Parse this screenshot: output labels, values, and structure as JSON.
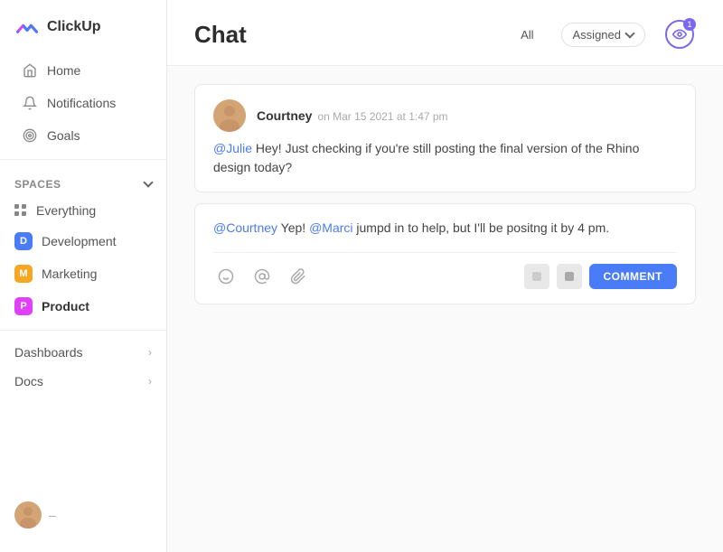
{
  "app": {
    "name": "ClickUp"
  },
  "sidebar": {
    "nav": [
      {
        "id": "home",
        "label": "Home",
        "icon": "home-icon"
      },
      {
        "id": "notifications",
        "label": "Notifications",
        "icon": "bell-icon"
      },
      {
        "id": "goals",
        "label": "Goals",
        "icon": "goal-icon"
      }
    ],
    "spaces_label": "Spaces",
    "spaces": [
      {
        "id": "everything",
        "label": "Everything",
        "type": "dots"
      },
      {
        "id": "development",
        "label": "Development",
        "type": "badge",
        "color": "blue",
        "letter": "D"
      },
      {
        "id": "marketing",
        "label": "Marketing",
        "type": "badge",
        "color": "orange",
        "letter": "M"
      },
      {
        "id": "product",
        "label": "Product",
        "type": "badge",
        "color": "pink",
        "letter": "P",
        "active": true
      }
    ],
    "expand_items": [
      {
        "id": "dashboards",
        "label": "Dashboards"
      },
      {
        "id": "docs",
        "label": "Docs"
      }
    ]
  },
  "main": {
    "title": "Chat",
    "filter_all": "All",
    "filter_assigned": "Assigned",
    "notification_count": "1",
    "messages": [
      {
        "id": "msg1",
        "author": "Courtney",
        "time": "on Mar 15 2021 at 1:47 pm",
        "mention": "@Julie",
        "text": " Hey! Just checking if you're still posting the final version of the Rhino design today?"
      }
    ],
    "reply": {
      "mention1": "@Courtney",
      "text1": " Yep! ",
      "mention2": "@Marci",
      "text2": " jumpd in to help, but I'll be positng it by 4 pm."
    },
    "comment_button": "COMMENT"
  }
}
